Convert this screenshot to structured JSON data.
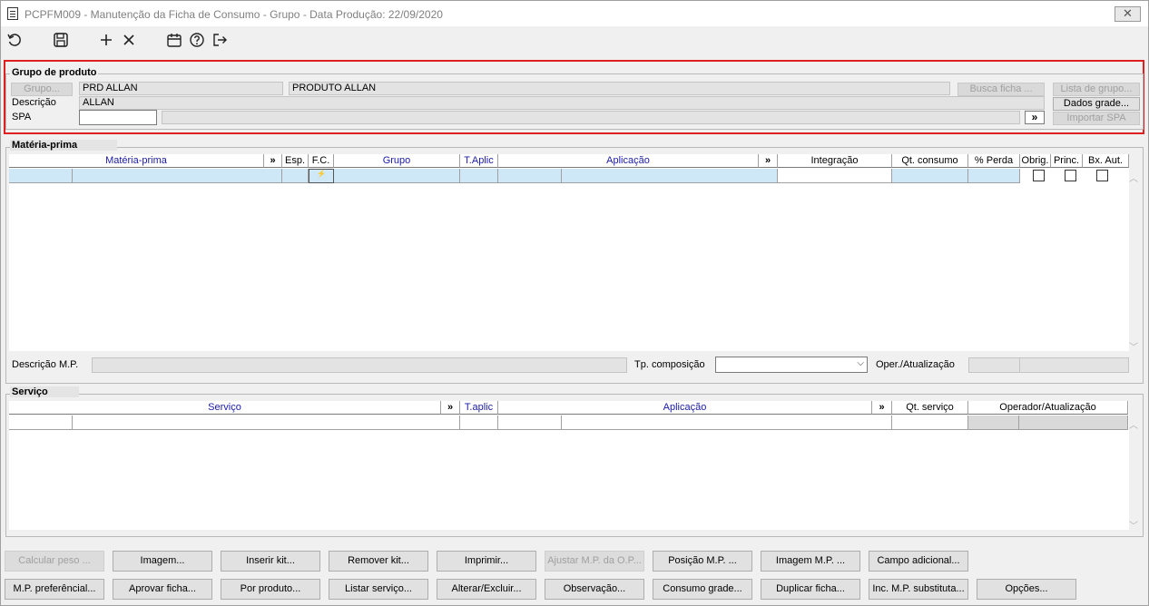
{
  "window": {
    "title": "PCPFM009 - Manutenção da Ficha de Consumo - Grupo - Data Produção: 22/09/2020",
    "close_label": "✕"
  },
  "toolbar": {
    "icons": [
      "refresh-icon",
      "save-icon",
      "add-icon",
      "delete-icon",
      "calendar-icon",
      "help-icon",
      "exit-icon"
    ]
  },
  "grupo_produto": {
    "legend": "Grupo de produto",
    "grupo_button": "Grupo...",
    "grupo_code": "PRD ALLAN",
    "grupo_name": "PRODUTO ALLAN",
    "descricao_label": "Descrição",
    "descricao_value": "ALLAN",
    "spa_label": "SPA",
    "spa_value": "",
    "spa_desc": "",
    "arrow": "»",
    "busca_ficha": "Busca ficha ...",
    "lista_grupo": "Lista de grupo...",
    "dados_grade": "Dados grade...",
    "importar_spa": "Importar SPA"
  },
  "materia_prima": {
    "legend": "Matéria-prima",
    "columns": {
      "materia_prima": "Matéria-prima",
      "arrow1": "»",
      "esp": "Esp.",
      "fc": "F.C.",
      "grupo": "Grupo",
      "taplic": "T.Aplic",
      "aplicacao": "Aplicação",
      "arrow2": "»",
      "integracao": "Integração",
      "qt_consumo": "Qt. consumo",
      "perda": "% Perda",
      "obrig": "Obrig.",
      "princ": "Princ.",
      "bx_aut": "Bx. Aut."
    },
    "descricao_mp_label": "Descrição M.P.",
    "tp_composicao_label": "Tp. composição",
    "oper_label": "Oper./Atualização"
  },
  "servico": {
    "legend": "Serviço",
    "columns": {
      "servico": "Serviço",
      "arrow1": "»",
      "taplic": "T.aplic",
      "aplicacao": "Aplicação",
      "arrow2": "»",
      "qt_servico": "Qt. serviço",
      "operador": "Operador/Atualização"
    }
  },
  "buttons_row1": [
    "Calcular peso ...",
    "Imagem...",
    "Inserir kit...",
    "Remover kit...",
    "Imprimir...",
    "Ajustar M.P. da O.P...",
    "Posição M.P. ...",
    "Imagem M.P. ...",
    "Campo adicional..."
  ],
  "buttons_row2": [
    "M.P. preferêncial...",
    "Aprovar ficha...",
    "Por produto...",
    "Listar serviço...",
    "Alterar/Excluir...",
    "Observação...",
    "Consumo grade...",
    "Duplicar ficha...",
    "Inc. M.P. substituta...",
    "Opções..."
  ]
}
